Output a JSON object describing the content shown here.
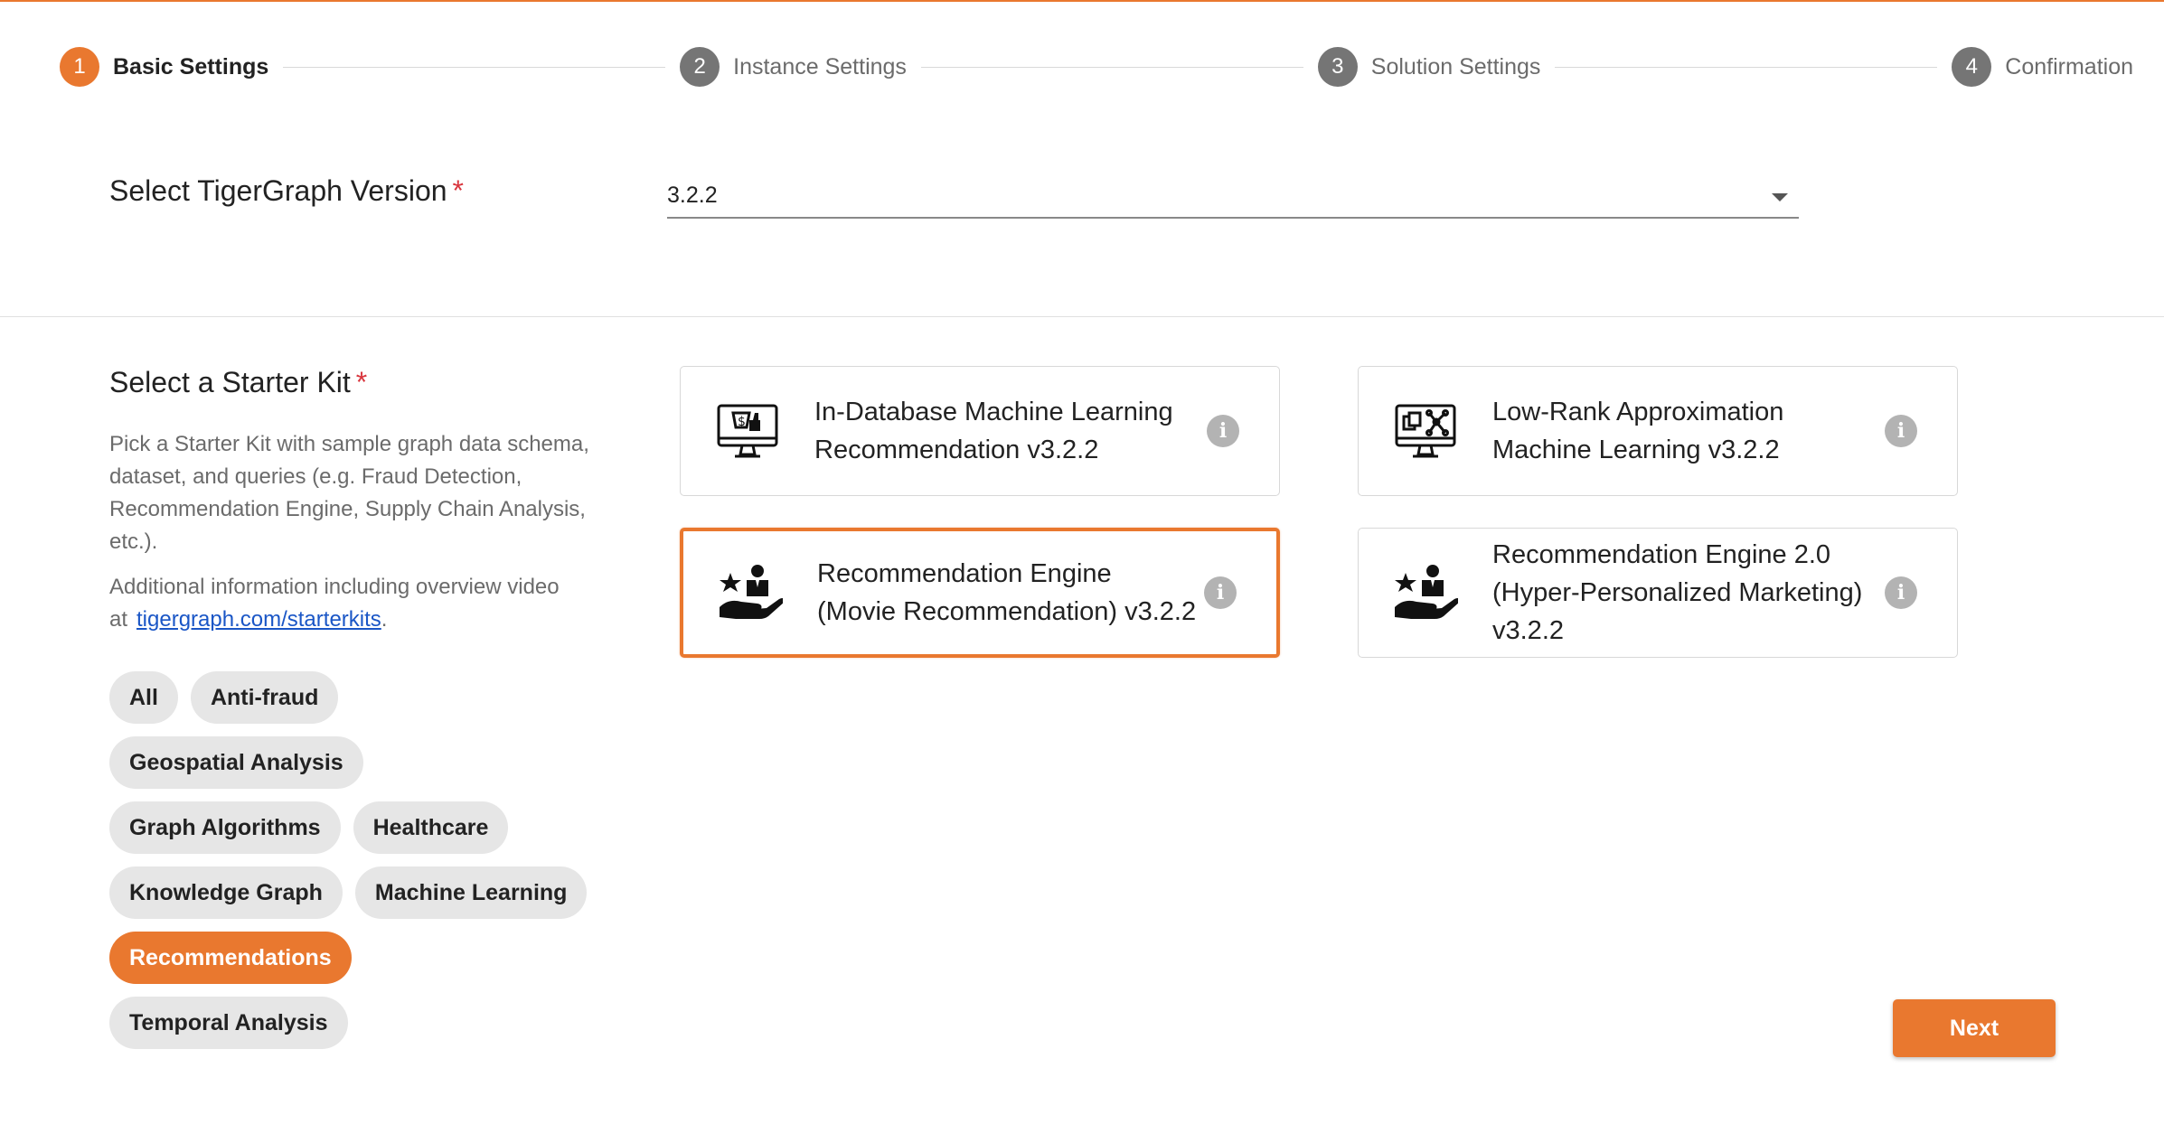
{
  "stepper": {
    "steps": [
      {
        "number": "1",
        "label": "Basic Settings"
      },
      {
        "number": "2",
        "label": "Instance Settings"
      },
      {
        "number": "3",
        "label": "Solution Settings"
      },
      {
        "number": "4",
        "label": "Confirmation"
      }
    ]
  },
  "version": {
    "label": "Select TigerGraph Version",
    "required_mark": "*",
    "selected_value": "3.2.2"
  },
  "starter_kit": {
    "title": "Select a Starter Kit",
    "required_mark": "*",
    "description": "Pick a Starter Kit with sample graph data schema, dataset, and queries (e.g. Fraud Detection, Recommendation Engine, Supply Chain Analysis, etc.).",
    "extra_prefix": "Additional information including overview video at",
    "link_text": "tigergraph.com/starterkits",
    "extra_suffix": ".",
    "filters": [
      "All",
      "Anti-fraud",
      "Geospatial Analysis",
      "Graph Algorithms",
      "Healthcare",
      "Knowledge Graph",
      "Machine Learning",
      "Recommendations",
      "Temporal Analysis"
    ],
    "active_filter": "Recommendations"
  },
  "cards": [
    {
      "title": "In-Database Machine Learning Recommendation v3.2.2",
      "icon": "monitor-shopping-icon",
      "selected": false
    },
    {
      "title": "Low-Rank Approximation Machine Learning v3.2.2",
      "icon": "monitor-network-icon",
      "selected": false
    },
    {
      "title": "Recommendation Engine (Movie Recommendation) v3.2.2",
      "icon": "hand-person-star-icon",
      "selected": true
    },
    {
      "title": "Recommendation Engine 2.0 (Hyper-Personalized Marketing) v3.2.2",
      "icon": "hand-person-star-icon",
      "selected": false
    }
  ],
  "info_glyph": "i",
  "next_label": "Next",
  "colors": {
    "accent": "#e9782f",
    "link": "#1a56c6",
    "required": "#d9363e"
  }
}
